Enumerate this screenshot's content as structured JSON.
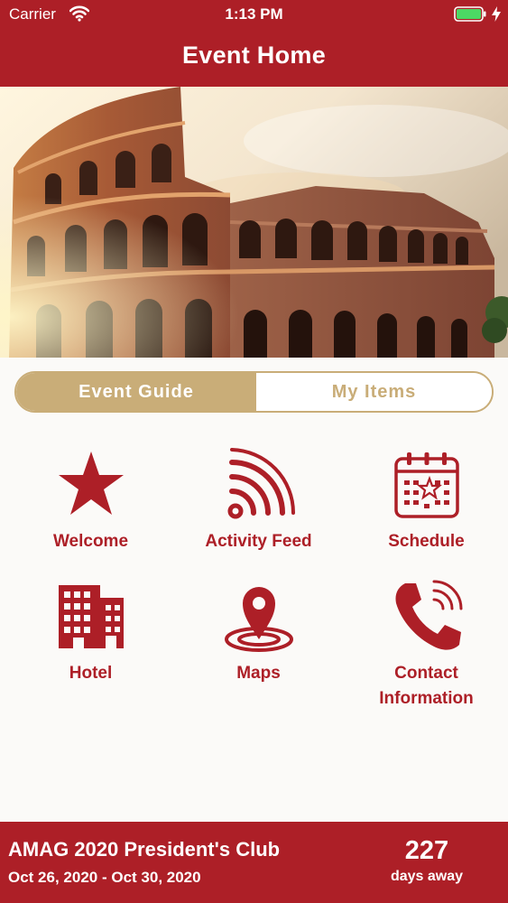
{
  "status_bar": {
    "carrier": "Carrier",
    "time": "1:13 PM",
    "icons": [
      "wifi-icon",
      "battery-icon",
      "charging-bolt-icon"
    ]
  },
  "header": {
    "title": "Event Home"
  },
  "hero": {
    "image": "colosseum-photo"
  },
  "segmented_control": {
    "tabs": [
      {
        "label": "Event Guide",
        "selected": true
      },
      {
        "label": "My Items",
        "selected": false
      }
    ]
  },
  "menu": {
    "items": [
      {
        "label": "Welcome",
        "icon": "star-icon"
      },
      {
        "label": "Activity Feed",
        "icon": "activity-feed-icon"
      },
      {
        "label": "Schedule",
        "icon": "calendar-icon"
      },
      {
        "label": "Hotel",
        "icon": "hotel-icon"
      },
      {
        "label": "Maps",
        "icon": "map-pin-icon"
      },
      {
        "label": "Contact Information",
        "icon": "phone-icon"
      }
    ]
  },
  "footer": {
    "event_name": "AMAG 2020 President's Club",
    "dates": "Oct 26, 2020 - Oct 30, 2020",
    "countdown_value": "227",
    "countdown_label": "days away"
  },
  "colors": {
    "brand_red": "#ad1f27",
    "gold": "#c9ad78",
    "background": "#fbfaf8"
  }
}
